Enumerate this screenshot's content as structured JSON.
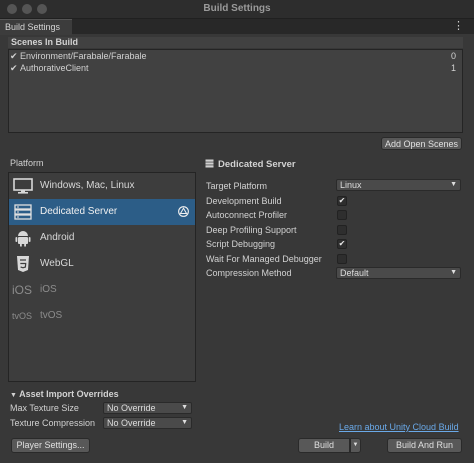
{
  "window": {
    "title": "Build Settings"
  },
  "tab": {
    "label": "Build Settings"
  },
  "scenes": {
    "header": "Scenes In Build",
    "items": [
      {
        "check": "✔",
        "name": "Environment/Farabale/Farabale",
        "index": "0"
      },
      {
        "check": "✔",
        "name": "AuthorativeClient",
        "index": "1"
      }
    ],
    "add_open_scenes": "Add Open Scenes"
  },
  "platform": {
    "header": "Platform",
    "items": [
      {
        "label": "Windows, Mac, Linux",
        "icon": "monitor-icon"
      },
      {
        "label": "Dedicated Server",
        "icon": "server-icon",
        "selected": true
      },
      {
        "label": "Android",
        "icon": "android-icon"
      },
      {
        "label": "WebGL",
        "icon": "html5-icon"
      },
      {
        "label": "iOS",
        "icon": "ios-icon",
        "icon_text": "iOS"
      },
      {
        "label": "tvOS",
        "icon": "tvos-icon",
        "icon_text": "tvOS"
      }
    ]
  },
  "settings": {
    "title": "Dedicated Server",
    "target_platform": {
      "label": "Target Platform",
      "value": "Linux"
    },
    "development_build": {
      "label": "Development Build",
      "check": "✔"
    },
    "autoconnect_profiler": {
      "label": "Autoconnect Profiler",
      "check": ""
    },
    "deep_profiling_support": {
      "label": "Deep Profiling Support",
      "check": ""
    },
    "script_debugging": {
      "label": "Script Debugging",
      "check": "✔"
    },
    "wait_for_managed_debugger": {
      "label": "Wait For Managed Debugger",
      "check": ""
    },
    "compression_method": {
      "label": "Compression Method",
      "value": "Default"
    }
  },
  "asset_import": {
    "header": "Asset Import Overrides",
    "max_texture_size": {
      "label": "Max Texture Size",
      "value": "No Override"
    },
    "texture_compression": {
      "label": "Texture Compression",
      "value": "No Override"
    }
  },
  "footer": {
    "cloud_build_link": "Learn about Unity Cloud Build",
    "player_settings": "Player Settings...",
    "build": "Build",
    "build_and_run": "Build And Run"
  },
  "colors": {
    "selection": "#2c5d87",
    "link": "#6aa9e8",
    "background": "#383838"
  }
}
